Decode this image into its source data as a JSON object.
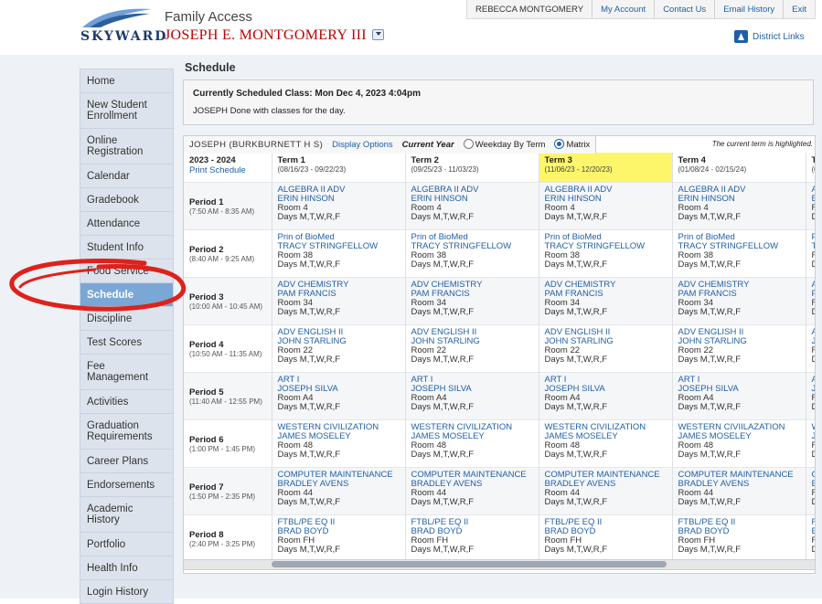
{
  "header": {
    "logo_text": "SKYWARD",
    "app_title": "Family Access",
    "student_name": "JOSEPH E. MONTGOMERY III",
    "top_nav": {
      "user": "REBECCA MONTGOMERY",
      "links": [
        "My Account",
        "Contact Us",
        "Email History",
        "Exit"
      ]
    },
    "district_links": "District Links"
  },
  "sidebar": {
    "items": [
      {
        "label": "Home"
      },
      {
        "label": "New Student Enrollment"
      },
      {
        "label": "Online Registration"
      },
      {
        "label": "Calendar"
      },
      {
        "label": "Gradebook"
      },
      {
        "label": "Attendance"
      },
      {
        "label": "Student Info"
      },
      {
        "label": "Food Service"
      },
      {
        "label": "Schedule",
        "active": true
      },
      {
        "label": "Discipline"
      },
      {
        "label": "Test Scores"
      },
      {
        "label": "Fee Management"
      },
      {
        "label": "Activities"
      },
      {
        "label": "Graduation Requirements"
      },
      {
        "label": "Career Plans"
      },
      {
        "label": "Endorsements"
      },
      {
        "label": "Academic History"
      },
      {
        "label": "Portfolio"
      },
      {
        "label": "Health Info"
      },
      {
        "label": "Login History"
      }
    ]
  },
  "main": {
    "page_title": "Schedule",
    "current_class": {
      "title": "Currently Scheduled Class: Mon Dec 4, 2023 4:04pm",
      "message": "JOSEPH Done with classes for the day."
    },
    "options": {
      "student_school": "JOSEPH  (BURKBURNETT H S)",
      "display_options": "Display Options",
      "current_year": "Current Year",
      "radio_weekday": "Weekday By Term",
      "radio_matrix": "Matrix",
      "selected": "Matrix",
      "highlight_note": "The current term is highlighted."
    },
    "schedule": {
      "year": "2023 - 2024",
      "print_label": "Print Schedule",
      "terms": [
        {
          "name": "Term 1",
          "dates": "(08/16/23 - 09/22/23)",
          "current": false
        },
        {
          "name": "Term 2",
          "dates": "(09/25/23 - 11/03/23)",
          "current": false
        },
        {
          "name": "Term 3",
          "dates": "(11/06/23 - 12/20/23)",
          "current": true
        },
        {
          "name": "Term 4",
          "dates": "(01/08/24 - 02/15/24)",
          "current": false
        },
        {
          "name": "Te",
          "dates": "(0",
          "current": false
        }
      ],
      "periods": [
        {
          "name": "Period 1",
          "time": "(7:50 AM - 8:35 AM)",
          "classes": [
            {
              "course": "ALGEBRA II ADV",
              "teacher": "ERIN HINSON",
              "room": "Room 4",
              "days": "Days M,T,W,R,F"
            },
            {
              "course": "ALGEBRA II ADV",
              "teacher": "ERIN HINSON",
              "room": "Room 4",
              "days": "Days M,T,W,R,F"
            },
            {
              "course": "ALGEBRA II ADV",
              "teacher": "ERIN HINSON",
              "room": "Room 4",
              "days": "Days M,T,W,R,F"
            },
            {
              "course": "ALGEBRA II ADV",
              "teacher": "ERIN HINSON",
              "room": "Room 4",
              "days": "Days M,T,W,R,F"
            },
            {
              "course": "A",
              "teacher": "E",
              "room": "R",
              "days": "D"
            }
          ]
        },
        {
          "name": "Period 2",
          "time": "(8:40 AM - 9:25 AM)",
          "classes": [
            {
              "course": "Prin of BioMed",
              "teacher": "TRACY STRINGFELLOW",
              "room": "Room 38",
              "days": "Days M,T,W,R,F"
            },
            {
              "course": "Prin of BioMed",
              "teacher": "TRACY STRINGFELLOW",
              "room": "Room 38",
              "days": "Days M,T,W,R,F"
            },
            {
              "course": "Prin of BioMed",
              "teacher": "TRACY STRINGFELLOW",
              "room": "Room 38",
              "days": "Days M,T,W,R,F"
            },
            {
              "course": "Prin of BioMed",
              "teacher": "TRACY STRINGFELLOW",
              "room": "Room 38",
              "days": "Days M,T,W,R,F"
            },
            {
              "course": "P",
              "teacher": "T",
              "room": "R",
              "days": "D"
            }
          ]
        },
        {
          "name": "Period 3",
          "time": "(10:00 AM - 10:45 AM)",
          "classes": [
            {
              "course": "ADV CHEMISTRY",
              "teacher": "PAM FRANCIS",
              "room": "Room 34",
              "days": "Days M,T,W,R,F"
            },
            {
              "course": "ADV CHEMISTRY",
              "teacher": "PAM FRANCIS",
              "room": "Room 34",
              "days": "Days M,T,W,R,F"
            },
            {
              "course": "ADV CHEMISTRY",
              "teacher": "PAM FRANCIS",
              "room": "Room 34",
              "days": "Days M,T,W,R,F"
            },
            {
              "course": "ADV CHEMISTRY",
              "teacher": "PAM FRANCIS",
              "room": "Room 34",
              "days": "Days M,T,W,R,F"
            },
            {
              "course": "A",
              "teacher": "P",
              "room": "R",
              "days": "D"
            }
          ]
        },
        {
          "name": "Period 4",
          "time": "(10:50 AM - 11:35 AM)",
          "classes": [
            {
              "course": "ADV ENGLISH II",
              "teacher": "JOHN STARLING",
              "room": "Room 22",
              "days": "Days M,T,W,R,F"
            },
            {
              "course": "ADV ENGLISH II",
              "teacher": "JOHN STARLING",
              "room": "Room 22",
              "days": "Days M,T,W,R,F"
            },
            {
              "course": "ADV ENGLISH II",
              "teacher": "JOHN STARLING",
              "room": "Room 22",
              "days": "Days M,T,W,R,F"
            },
            {
              "course": "ADV ENGLISH II",
              "teacher": "JOHN STARLING",
              "room": "Room 22",
              "days": "Days M,T,W,R,F"
            },
            {
              "course": "A",
              "teacher": "J",
              "room": "R",
              "days": "D"
            }
          ]
        },
        {
          "name": "Period 5",
          "time": "(11:40 AM - 12:55 PM)",
          "classes": [
            {
              "course": "ART I",
              "teacher": "JOSEPH SILVA",
              "room": "Room A4",
              "days": "Days M,T,W,R,F"
            },
            {
              "course": "ART I",
              "teacher": "JOSEPH SILVA",
              "room": "Room A4",
              "days": "Days M,T,W,R,F"
            },
            {
              "course": "ART I",
              "teacher": "JOSEPH SILVA",
              "room": "Room A4",
              "days": "Days M,T,W,R,F"
            },
            {
              "course": "ART I",
              "teacher": "JOSEPH SILVA",
              "room": "Room A4",
              "days": "Days M,T,W,R,F"
            },
            {
              "course": "A",
              "teacher": "J",
              "room": "R",
              "days": "D"
            }
          ]
        },
        {
          "name": "Period 6",
          "time": "(1:00 PM - 1:45 PM)",
          "classes": [
            {
              "course": "WESTERN CIVILIZATION",
              "teacher": "JAMES MOSELEY",
              "room": "Room 48",
              "days": "Days M,T,W,R,F"
            },
            {
              "course": "WESTERN CIVILIZATION",
              "teacher": "JAMES MOSELEY",
              "room": "Room 48",
              "days": "Days M,T,W,R,F"
            },
            {
              "course": "WESTERN CIVILIZATION",
              "teacher": "JAMES MOSELEY",
              "room": "Room 48",
              "days": "Days M,T,W,R,F"
            },
            {
              "course": "WESTERN CIVIILAZATION",
              "teacher": "JAMES MOSELEY",
              "room": "Room 48",
              "days": "Days M,T,W,R,F"
            },
            {
              "course": "W",
              "teacher": "J",
              "room": "R",
              "days": "D"
            }
          ]
        },
        {
          "name": "Period 7",
          "time": "(1:50 PM - 2:35 PM)",
          "classes": [
            {
              "course": "COMPUTER MAINTENANCE",
              "teacher": "BRADLEY AVENS",
              "room": "Room 44",
              "days": "Days M,T,W,R,F"
            },
            {
              "course": "COMPUTER MAINTENANCE",
              "teacher": "BRADLEY AVENS",
              "room": "Room 44",
              "days": "Days M,T,W,R,F"
            },
            {
              "course": "COMPUTER MAINTENANCE",
              "teacher": "BRADLEY AVENS",
              "room": "Room 44",
              "days": "Days M,T,W,R,F"
            },
            {
              "course": "COMPUTER MAINTENANCE",
              "teacher": "BRADLEY AVENS",
              "room": "Room 44",
              "days": "Days M,T,W,R,F"
            },
            {
              "course": "C",
              "teacher": "B",
              "room": "R",
              "days": "D"
            }
          ]
        },
        {
          "name": "Period 8",
          "time": "(2:40 PM - 3:25 PM)",
          "classes": [
            {
              "course": "FTBL/PE EQ II",
              "teacher": "BRAD BOYD",
              "room": "Room FH",
              "days": "Days M,T,W,R,F"
            },
            {
              "course": "FTBL/PE EQ II",
              "teacher": "BRAD BOYD",
              "room": "Room FH",
              "days": "Days M,T,W,R,F"
            },
            {
              "course": "FTBL/PE EQ II",
              "teacher": "BRAD BOYD",
              "room": "Room FH",
              "days": "Days M,T,W,R,F"
            },
            {
              "course": "FTBL/PE EQ II",
              "teacher": "BRAD BOYD",
              "room": "Room FH",
              "days": "Days M,T,W,R,F"
            },
            {
              "course": "F",
              "teacher": "B",
              "room": "R",
              "days": "D"
            }
          ]
        }
      ]
    }
  },
  "colors": {
    "link": "#1f5fa8",
    "student_name": "#bb0000",
    "current_term": "#fdf66b",
    "sidebar_active": "#7aa7d6",
    "annotation": "#e0211b"
  },
  "icons": {
    "student_dropdown": "chevron-down-icon",
    "district_links": "district-icon",
    "annotation_circle": "red-circle-annotation"
  }
}
